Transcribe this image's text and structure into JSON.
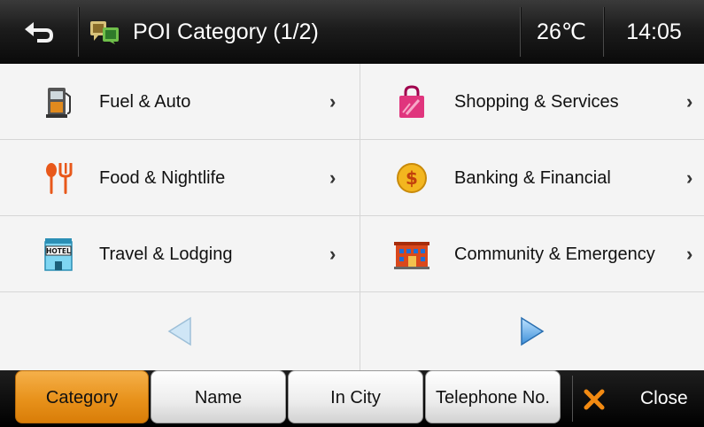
{
  "header": {
    "title": "POI Category (1/2)",
    "temperature": "26℃",
    "time": "14:05"
  },
  "categories": [
    {
      "label": "Fuel & Auto",
      "icon": "fuel-pump-icon"
    },
    {
      "label": "Shopping & Services",
      "icon": "shopping-bag-icon"
    },
    {
      "label": "Food & Nightlife",
      "icon": "fork-knife-icon"
    },
    {
      "label": "Banking & Financial",
      "icon": "dollar-coin-icon"
    },
    {
      "label": "Travel & Lodging",
      "icon": "hotel-icon"
    },
    {
      "label": "Community & Emergency",
      "icon": "building-icon"
    }
  ],
  "chevron": "›",
  "tabs": [
    {
      "label": "Category",
      "active": true
    },
    {
      "label": "Name",
      "active": false
    },
    {
      "label": "In City",
      "active": false
    },
    {
      "label": "Telephone No.",
      "active": false
    }
  ],
  "close_label": "Close",
  "colors": {
    "accent": "#e8921b",
    "header": "#1c1c1c"
  }
}
